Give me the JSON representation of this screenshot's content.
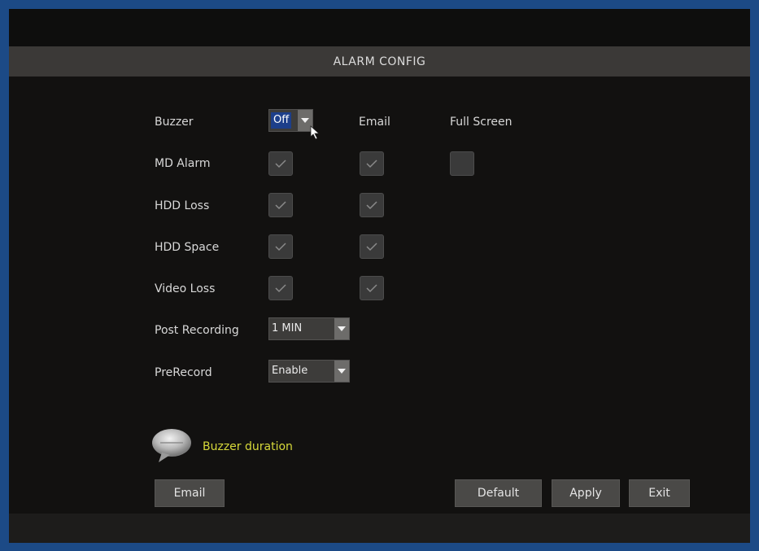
{
  "title": "ALARM CONFIG",
  "columns": {
    "buzzer": "Buzzer",
    "email": "Email",
    "full_screen": "Full Screen"
  },
  "buzzer_select": {
    "value": "Off"
  },
  "rows": [
    {
      "label": "MD Alarm",
      "buzzer": true,
      "email": true,
      "full_screen": false
    },
    {
      "label": "HDD Loss",
      "buzzer": true,
      "email": true
    },
    {
      "label": "HDD Space",
      "buzzer": true,
      "email": true
    },
    {
      "label": "Video Loss",
      "buzzer": true,
      "email": true
    }
  ],
  "post_recording": {
    "label": "Post Recording",
    "value": "1 MIN"
  },
  "prerecord": {
    "label": "PreRecord",
    "value": "Enable"
  },
  "hint": {
    "icon": "speech-bubble-icon",
    "text": "Buzzer duration"
  },
  "buttons": {
    "email": "Email",
    "default": "Default",
    "apply": "Apply",
    "exit": "Exit"
  },
  "colors": {
    "frame": "#1c4a86",
    "background": "#121110",
    "titlebar": "#3b3937",
    "hint_text": "#d6d83a",
    "selected_value": "#1d3f8a"
  }
}
